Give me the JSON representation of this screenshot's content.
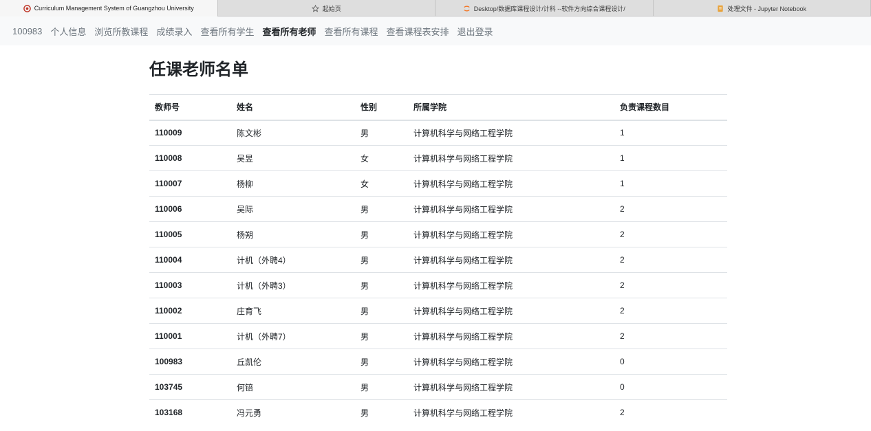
{
  "browser": {
    "tabs": [
      {
        "title": "Curriculum Management System of Guangzhou University",
        "icon": "university-logo-icon",
        "active": true
      },
      {
        "title": "起始页",
        "icon": "star-icon",
        "active": false
      },
      {
        "title": "Desktop/数据库课程设计/计科 --软件方向综合课程设计/",
        "icon": "jupyter-icon",
        "active": false
      },
      {
        "title": "处理文件 - Jupyter Notebook",
        "icon": "notebook-icon",
        "active": false
      }
    ]
  },
  "nav": {
    "brand": "100983",
    "links": [
      "个人信息",
      "浏览所教课程",
      "成绩录入",
      "查看所有学生",
      "查看所有老师",
      "查看所有课程",
      "查看课程表安排",
      "退出登录"
    ],
    "active_index": 4
  },
  "page": {
    "title": "任课老师名单"
  },
  "table": {
    "headers": [
      "教师号",
      "姓名",
      "性别",
      "所属学院",
      "负责课程数目"
    ],
    "rows": [
      [
        "110009",
        "陈文彬",
        "男",
        "计算机科学与网络工程学院",
        "1"
      ],
      [
        "110008",
        "吴昱",
        "女",
        "计算机科学与网络工程学院",
        "1"
      ],
      [
        "110007",
        "杨柳",
        "女",
        "计算机科学与网络工程学院",
        "1"
      ],
      [
        "110006",
        "吴际",
        "男",
        "计算机科学与网络工程学院",
        "2"
      ],
      [
        "110005",
        "杨朔",
        "男",
        "计算机科学与网络工程学院",
        "2"
      ],
      [
        "110004",
        "计机（外聘4）",
        "男",
        "计算机科学与网络工程学院",
        "2"
      ],
      [
        "110003",
        "计机（外聘3）",
        "男",
        "计算机科学与网络工程学院",
        "2"
      ],
      [
        "110002",
        "庄育飞",
        "男",
        "计算机科学与网络工程学院",
        "2"
      ],
      [
        "110001",
        "计机（外聘7）",
        "男",
        "计算机科学与网络工程学院",
        "2"
      ],
      [
        "100983",
        "丘凯伦",
        "男",
        "计算机科学与网络工程学院",
        "0"
      ],
      [
        "103745",
        "何锫",
        "男",
        "计算机科学与网络工程学院",
        "0"
      ],
      [
        "103168",
        "冯元勇",
        "男",
        "计算机科学与网络工程学院",
        "2"
      ]
    ]
  },
  "colors": {
    "navbar_bg": "#f8f9fa",
    "nav_link": "#6c757d",
    "nav_active": "#212529",
    "table_border": "#dee2e6",
    "logo_red": "#c0392b",
    "jupyter_orange": "#f37726",
    "notebook_amber": "#e8a33c"
  }
}
